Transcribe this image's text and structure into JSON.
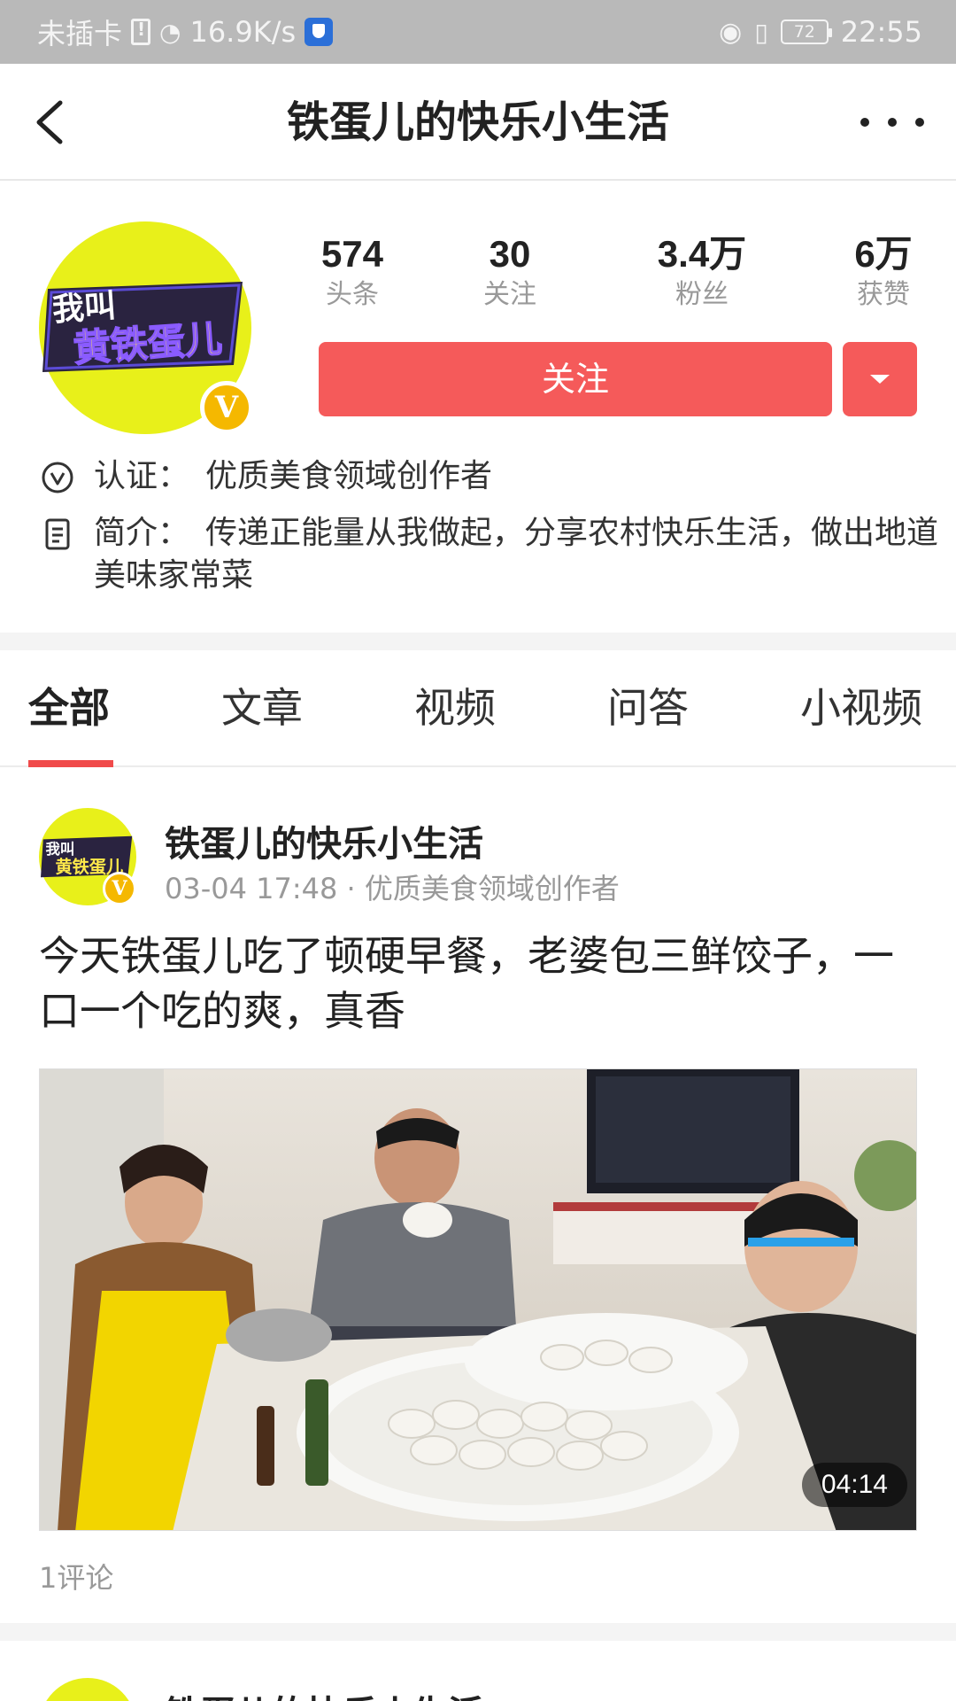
{
  "status_bar": {
    "carrier": "未插卡",
    "speed": "16.9K/s",
    "battery": "72",
    "time": "22:55"
  },
  "header": {
    "title": "铁蛋儿的快乐小生活"
  },
  "profile": {
    "avatar_text_line1": "我叫",
    "avatar_text_line2": "黄铁蛋儿",
    "badge": "V",
    "stats": [
      {
        "value": "574",
        "label": "头条"
      },
      {
        "value": "30",
        "label": "关注"
      },
      {
        "value": "3.4万",
        "label": "粉丝"
      },
      {
        "value": "6万",
        "label": "获赞"
      }
    ],
    "follow_label": "关注",
    "verification_label": "认证：",
    "verification_value": "优质美食领域创作者",
    "intro_label": "简介：",
    "intro_value": "传递正能量从我做起，分享农村快乐生活，做出地道美味家常菜"
  },
  "tabs": [
    {
      "label": "全部",
      "active": true
    },
    {
      "label": "文章",
      "active": false
    },
    {
      "label": "视频",
      "active": false
    },
    {
      "label": "问答",
      "active": false
    },
    {
      "label": "小视频",
      "active": false
    }
  ],
  "post": {
    "author": "铁蛋儿的快乐小生活",
    "meta": "03-04 17:48 · 优质美食领域创作者",
    "title": "今天铁蛋儿吃了顿硬早餐，老婆包三鲜饺子，一口一个吃的爽，真香",
    "duration": "04:14",
    "comments": "1评论"
  },
  "next_post": {
    "author": "铁蛋儿的快乐小生活"
  },
  "colors": {
    "accent": "#f55a5a",
    "tab_indicator": "#f04a4a",
    "avatar_bg": "#e8f01a",
    "badge": "#f5b800"
  }
}
